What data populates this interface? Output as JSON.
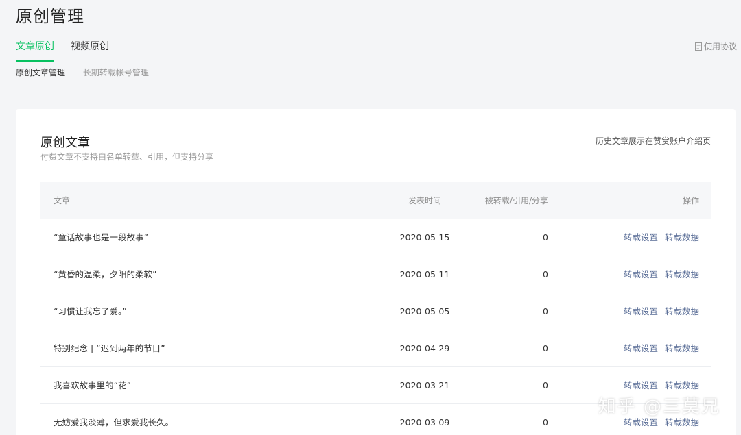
{
  "page": {
    "title": "原创管理"
  },
  "tabs": [
    {
      "label": "文章原创",
      "active": true
    },
    {
      "label": "视频原创",
      "active": false
    }
  ],
  "usage_link": {
    "label": "使用协议",
    "icon": "document-icon"
  },
  "subnav": [
    {
      "label": "原创文章管理",
      "active": true
    },
    {
      "label": "长期转载帐号管理",
      "active": false
    }
  ],
  "card": {
    "title": "原创文章",
    "description": "付费文章不支持白名单转载、引用，但支持分享",
    "link": "历史文章展示在赞赏账户介绍页"
  },
  "table": {
    "headers": {
      "title": "文章",
      "date": "发表时间",
      "count": "被转载/引用/分享",
      "ops": "操作"
    },
    "op_labels": {
      "settings": "转载设置",
      "data": "转载数据"
    },
    "rows": [
      {
        "title": "“童话故事也是一段故事”",
        "date": "2020-05-15",
        "count": "0"
      },
      {
        "title": "“黄昏的温柔，夕阳的柔软”",
        "date": "2020-05-11",
        "count": "0"
      },
      {
        "title": "“习惯让我忘了爱。”",
        "date": "2020-05-05",
        "count": "0"
      },
      {
        "title": "特别纪念 | “迟到两年的节目”",
        "date": "2020-04-29",
        "count": "0"
      },
      {
        "title": "我喜欢故事里的“花”",
        "date": "2020-03-21",
        "count": "0"
      },
      {
        "title": "无妨爱我淡薄，但求爱我长久。",
        "date": "2020-03-09",
        "count": "0"
      }
    ]
  },
  "watermark": "知乎 @三莫兄",
  "colors": {
    "accent": "#07c160",
    "link": "#576b95"
  }
}
